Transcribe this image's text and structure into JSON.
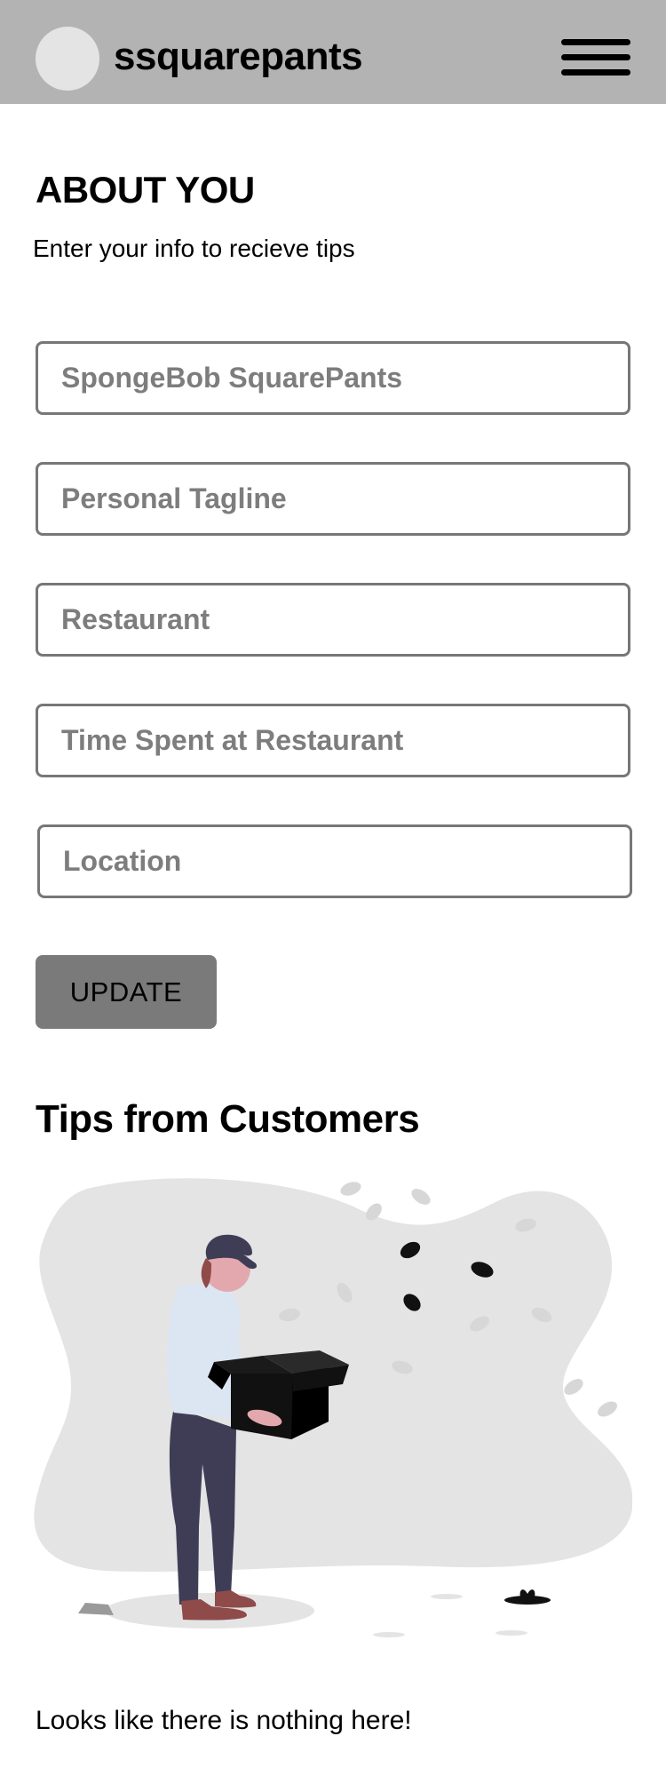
{
  "header": {
    "username": "ssquarepants",
    "avatar_icon": "user-avatar-placeholder",
    "menu_icon": "hamburger-menu-icon"
  },
  "about": {
    "title": "ABOUT YOU",
    "subtitle": "Enter your info to recieve tips"
  },
  "form": {
    "name_placeholder": "SpongeBob SquarePants",
    "tagline_placeholder": "Personal Tagline",
    "restaurant_placeholder": "Restaurant",
    "time_placeholder": "Time Spent at Restaurant",
    "location_placeholder": "Location",
    "update_label": "UPDATE"
  },
  "tips": {
    "heading": "Tips from Customers",
    "illustration_icon": "empty-box-illustration",
    "empty_message": "Looks like there is nothing here!"
  },
  "colors": {
    "header_bg": "#b3b3b3",
    "button_bg": "#7a7a7a",
    "field_border": "#777777"
  }
}
